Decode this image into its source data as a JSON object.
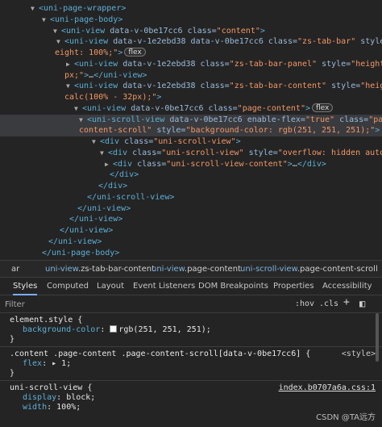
{
  "tree": {
    "lines": [
      {
        "tri": "▼",
        "parts": [
          {
            "c": "tag",
            "t": "<uni-page-wrapper>"
          }
        ]
      },
      {
        "tri": "▼",
        "parts": [
          {
            "c": "tag",
            "t": "<uni-page-body>"
          }
        ]
      },
      {
        "tri": "▼",
        "parts": [
          {
            "c": "tag",
            "t": "<uni-view "
          },
          {
            "c": "attr",
            "t": "data-v-0be17cc6 class="
          },
          {
            "c": "val",
            "t": "\"content\""
          },
          {
            "c": "tag",
            "t": ">"
          }
        ]
      },
      {
        "tri": "▼",
        "parts": [
          {
            "c": "tag",
            "t": "<uni-view "
          },
          {
            "c": "attr",
            "t": "data-v-1e2ebd38 data-v-0be17cc6 class="
          },
          {
            "c": "val",
            "t": "\"zs-tab-bar\""
          },
          {
            "c": "attr",
            "t": " style="
          },
          {
            "c": "val",
            "t": "\"h"
          }
        ]
      },
      {
        "tri": "",
        "parts": [
          {
            "c": "val",
            "t": "eight: 100%;\""
          },
          {
            "c": "tag",
            "t": ">"
          },
          {
            "c": "badge",
            "t": "flex"
          }
        ]
      },
      {
        "tri": "▶",
        "parts": [
          {
            "c": "tag",
            "t": "<uni-view "
          },
          {
            "c": "attr",
            "t": "data-v-1e2ebd38 class="
          },
          {
            "c": "val",
            "t": "\"zs-tab-bar-panel\""
          },
          {
            "c": "attr",
            "t": " style="
          },
          {
            "c": "val",
            "t": "\"height: 32"
          }
        ]
      },
      {
        "tri": "",
        "parts": [
          {
            "c": "val",
            "t": "px;\""
          },
          {
            "c": "tag",
            "t": ">"
          },
          {
            "c": "txt",
            "t": "…"
          },
          {
            "c": "tag",
            "t": "</uni-view>"
          }
        ]
      },
      {
        "tri": "▼",
        "parts": [
          {
            "c": "tag",
            "t": "<uni-view "
          },
          {
            "c": "attr",
            "t": "data-v-1e2ebd38 class="
          },
          {
            "c": "val",
            "t": "\"zs-tab-bar-content\""
          },
          {
            "c": "attr",
            "t": " style="
          },
          {
            "c": "val",
            "t": "\"height:"
          }
        ]
      },
      {
        "tri": "",
        "parts": [
          {
            "c": "val",
            "t": "calc(100% - 32px);\""
          },
          {
            "c": "tag",
            "t": ">"
          }
        ]
      },
      {
        "tri": "▼",
        "parts": [
          {
            "c": "tag",
            "t": "<uni-view "
          },
          {
            "c": "attr",
            "t": "data-v-0be17cc6 class="
          },
          {
            "c": "val",
            "t": "\"page-content\""
          },
          {
            "c": "tag",
            "t": ">"
          },
          {
            "c": "badge",
            "t": "flex"
          }
        ]
      },
      {
        "tri": "▼",
        "parts": [
          {
            "c": "tag",
            "t": "<uni-scroll-view "
          },
          {
            "c": "attr",
            "t": "data-v-0be17cc6 enable-flex="
          },
          {
            "c": "val",
            "t": "\"true\""
          },
          {
            "c": "attr",
            "t": " class="
          },
          {
            "c": "val",
            "t": "\"page-"
          }
        ]
      },
      {
        "tri": "",
        "parts": [
          {
            "c": "val",
            "t": "content-scroll\""
          },
          {
            "c": "attr",
            "t": " style="
          },
          {
            "c": "val",
            "t": "\"background-color: rgb(251, 251, 251);\""
          },
          {
            "c": "tag",
            "t": ">"
          },
          {
            "c": "eq",
            "t": " == $0"
          }
        ]
      },
      {
        "tri": "▼",
        "parts": [
          {
            "c": "tag",
            "t": "<div "
          },
          {
            "c": "attr",
            "t": "class="
          },
          {
            "c": "val",
            "t": "\"uni-scroll-view\""
          },
          {
            "c": "tag",
            "t": ">"
          }
        ]
      },
      {
        "tri": "▼",
        "parts": [
          {
            "c": "tag",
            "t": "<div "
          },
          {
            "c": "attr",
            "t": "class="
          },
          {
            "c": "val",
            "t": "\"uni-scroll-view\""
          },
          {
            "c": "attr",
            "t": " style="
          },
          {
            "c": "val",
            "t": "\"overflow: hidden auto;\""
          },
          {
            "c": "tag",
            "t": ">"
          }
        ]
      },
      {
        "tri": "▶",
        "parts": [
          {
            "c": "tag",
            "t": "<div "
          },
          {
            "c": "attr",
            "t": "class="
          },
          {
            "c": "val",
            "t": "\"uni-scroll-view-content\""
          },
          {
            "c": "tag",
            "t": ">"
          },
          {
            "c": "txt",
            "t": "…"
          },
          {
            "c": "tag",
            "t": "</div>"
          }
        ]
      },
      {
        "tri": "",
        "parts": [
          {
            "c": "tag",
            "t": "</div>"
          }
        ]
      },
      {
        "tri": "",
        "parts": [
          {
            "c": "tag",
            "t": "</div>"
          }
        ]
      },
      {
        "tri": "",
        "parts": [
          {
            "c": "tag",
            "t": "</uni-scroll-view>"
          }
        ]
      },
      {
        "tri": "",
        "parts": [
          {
            "c": "tag",
            "t": "</uni-view>"
          }
        ]
      },
      {
        "tri": "",
        "parts": [
          {
            "c": "tag",
            "t": "</uni-view>"
          }
        ]
      },
      {
        "tri": "",
        "parts": [
          {
            "c": "tag",
            "t": "</uni-view>"
          }
        ]
      },
      {
        "tri": "",
        "parts": [
          {
            "c": "tag",
            "t": "</uni-view>"
          }
        ]
      },
      {
        "tri": "",
        "parts": [
          {
            "c": "tag",
            "t": "</uni-page-body>"
          }
        ]
      }
    ]
  },
  "breadcrumbs": [
    {
      "text": "…",
      "tag": "",
      "rest": "ar"
    },
    {
      "text": "",
      "tag": "uni-view",
      "rest": ".zs-tab-bar-content"
    },
    {
      "text": "",
      "tag": "uni-view",
      "rest": ".page-content"
    },
    {
      "text": "",
      "tag": "uni-scroll-view",
      "rest": ".page-content-scroll"
    }
  ],
  "tabs": [
    "Styles",
    "Computed",
    "Layout",
    "Event Listeners",
    "DOM Breakpoints",
    "Properties",
    "Accessibility"
  ],
  "filter": {
    "placeholder": "Filter",
    "hov": ":hov",
    "cls": ".cls",
    "add": "+",
    "toggle": "◧"
  },
  "rules": [
    {
      "selector": "element.style {",
      "props": [
        {
          "name": "background-color",
          "value": "rgb(251, 251, 251);",
          "swatch": "#fbfbfb"
        }
      ],
      "source": "",
      "close": "}"
    },
    {
      "selector": ".content .page-content .page-content-scroll[data-v-0be17cc6] {",
      "props": [
        {
          "name": "flex",
          "value": "▸ 1;"
        }
      ],
      "source": "<style>",
      "close": "}"
    },
    {
      "selector": "uni-scroll-view {",
      "props": [
        {
          "name": "display",
          "value": "block;"
        },
        {
          "name": "width",
          "value": "100%;"
        }
      ],
      "source": "index.b0707a6a.css:1",
      "close": ""
    }
  ],
  "watermark": "CSDN @TA远方",
  "colors": {
    "accent": "#7cacf8",
    "tag": "#5db0d7",
    "attr": "#9bbbdc",
    "value": "#f29766",
    "bg": "#242424"
  }
}
